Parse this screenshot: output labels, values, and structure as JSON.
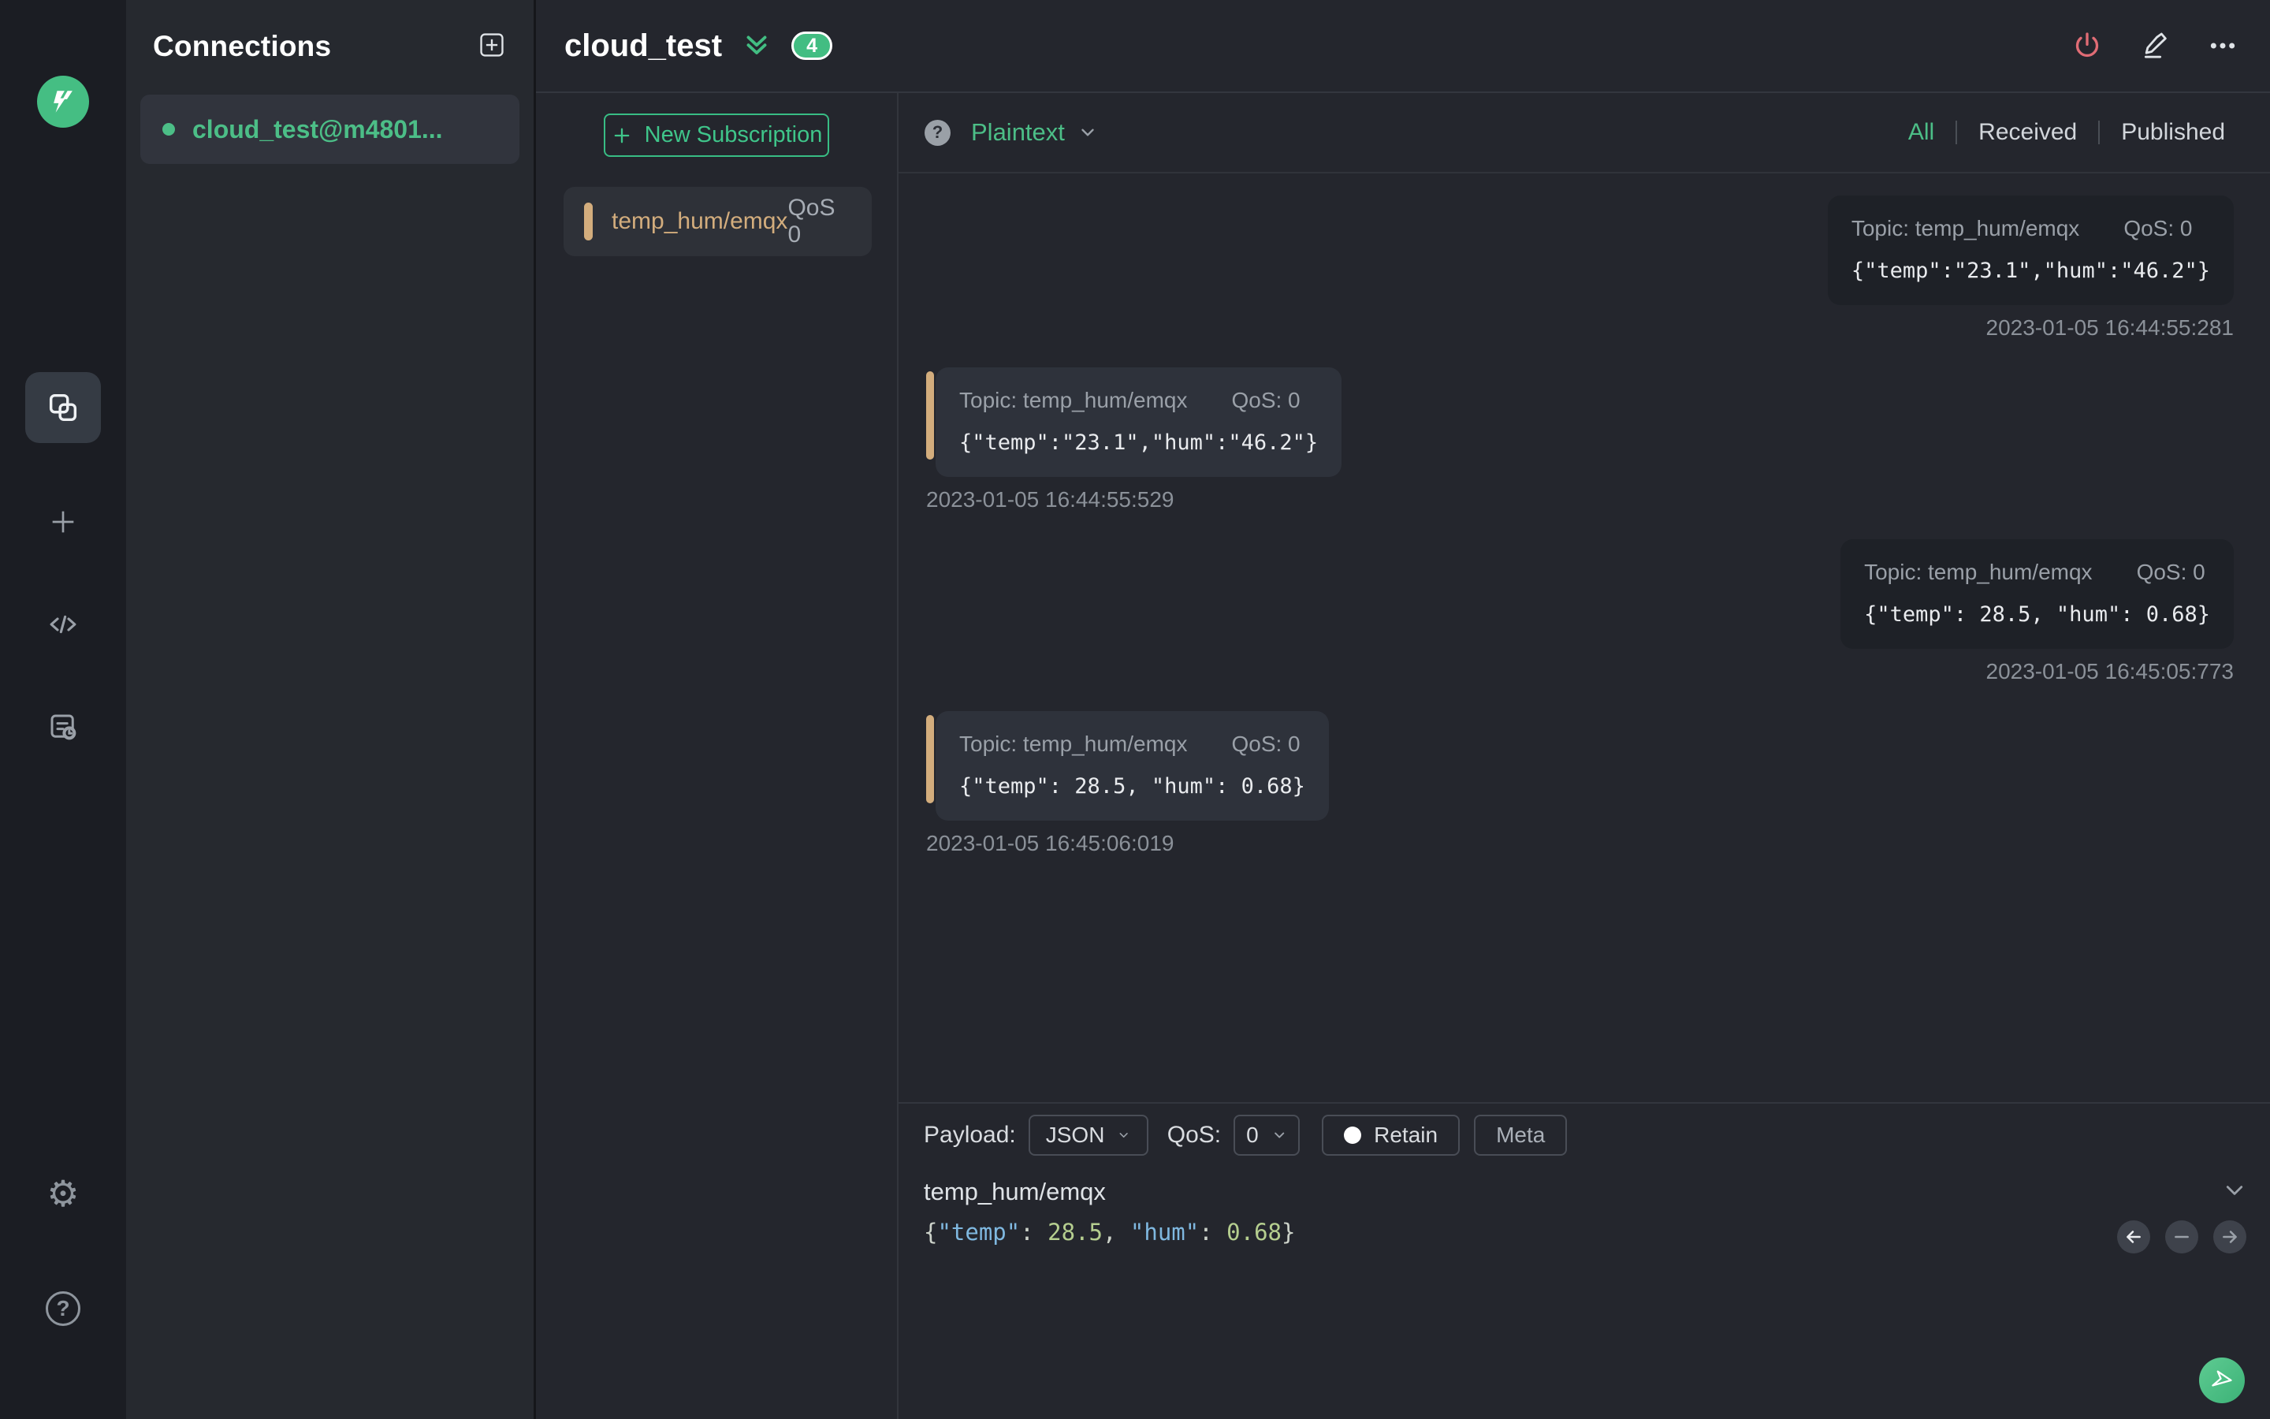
{
  "sidebar": {
    "gear_glyph": "⚙",
    "help_glyph": "?"
  },
  "connections": {
    "title": "Connections",
    "items": [
      {
        "name": "cloud_test@m4801...",
        "status": "connected"
      }
    ]
  },
  "header": {
    "title": "cloud_test",
    "badge": "4"
  },
  "subscriptions": {
    "new_button": "New Subscription",
    "items": [
      {
        "topic": "temp_hum/emqx",
        "qos": "QoS 0"
      }
    ]
  },
  "messages": {
    "help_glyph": "?",
    "format": "Plaintext",
    "filters": {
      "all": "All",
      "received": "Received",
      "published": "Published"
    },
    "active_filter": "All",
    "items": [
      {
        "direction": "published",
        "topic": "Topic: temp_hum/emqx",
        "qos": "QoS: 0",
        "payload": "{\"temp\":\"23.1\",\"hum\":\"46.2\"}",
        "time": "2023-01-05 16:44:55:281"
      },
      {
        "direction": "received",
        "topic": "Topic: temp_hum/emqx",
        "qos": "QoS: 0",
        "payload": "{\"temp\":\"23.1\",\"hum\":\"46.2\"}",
        "time": "2023-01-05 16:44:55:529"
      },
      {
        "direction": "published",
        "topic": "Topic: temp_hum/emqx",
        "qos": "QoS: 0",
        "payload": "{\"temp\": 28.5, \"hum\": 0.68}",
        "time": "2023-01-05 16:45:05:773"
      },
      {
        "direction": "received",
        "topic": "Topic: temp_hum/emqx",
        "qos": "QoS: 0",
        "payload": "{\"temp\": 28.5, \"hum\": 0.68}",
        "time": "2023-01-05 16:45:06:019"
      }
    ]
  },
  "publish": {
    "payload_label": "Payload:",
    "format_value": "JSON",
    "qos_label": "QoS:",
    "qos_value": "0",
    "retain_label": "Retain",
    "meta_label": "Meta",
    "topic": "temp_hum/emqx",
    "payload_text": "{\"temp\": 28.5, \"hum\": 0.68}",
    "tokens": [
      {
        "t": "punct",
        "text": "{"
      },
      {
        "t": "key",
        "text": "\"temp\""
      },
      {
        "t": "punct",
        "text": ": "
      },
      {
        "t": "num",
        "text": "28.5"
      },
      {
        "t": "punct",
        "text": ", "
      },
      {
        "t": "key",
        "text": "\"hum\""
      },
      {
        "t": "punct",
        "text": ": "
      },
      {
        "t": "num",
        "text": "0.68"
      },
      {
        "t": "punct",
        "text": "}"
      }
    ]
  },
  "colors": {
    "accent_green": "#42bd82",
    "accent_tan": "#d3ad7d",
    "danger_red": "#e06c75"
  }
}
